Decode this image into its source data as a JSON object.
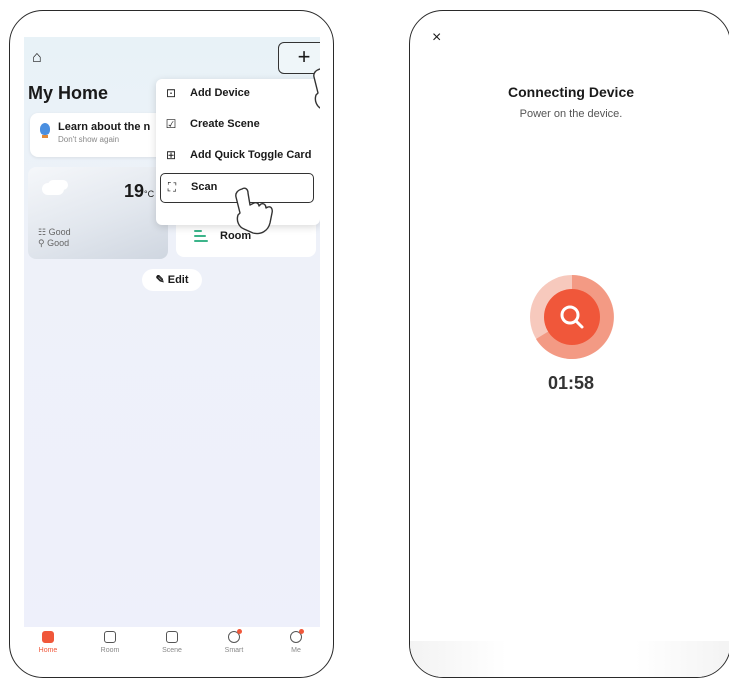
{
  "left": {
    "header": {
      "plus_label": "+",
      "title": "My Home"
    },
    "banner": {
      "title": "Learn about the n",
      "subtitle": "Don't show again"
    },
    "weather": {
      "temp": "19",
      "unit": "°C",
      "air_1": "Good",
      "air_2": "Good"
    },
    "room_card": {
      "label": "Room"
    },
    "edit": {
      "label": "Edit"
    },
    "menu": {
      "items": [
        {
          "label": "Add Device",
          "icon": "add-device-icon"
        },
        {
          "label": "Create Scene",
          "icon": "create-scene-icon"
        },
        {
          "label": "Add Quick Toggle Card",
          "icon": "quick-toggle-icon"
        },
        {
          "label": "Scan",
          "icon": "scan-icon"
        }
      ]
    },
    "tabs": [
      {
        "label": "Home",
        "icon": "home-icon"
      },
      {
        "label": "Room",
        "icon": "room-icon"
      },
      {
        "label": "Scene",
        "icon": "scene-icon"
      },
      {
        "label": "Smart",
        "icon": "smart-icon"
      },
      {
        "label": "Me",
        "icon": "me-icon"
      }
    ],
    "accent": "#f0573a"
  },
  "right": {
    "close": "×",
    "title": "Connecting Device",
    "subtitle": "Power on the device.",
    "timer": "01:58",
    "accent": "#f0573a"
  }
}
